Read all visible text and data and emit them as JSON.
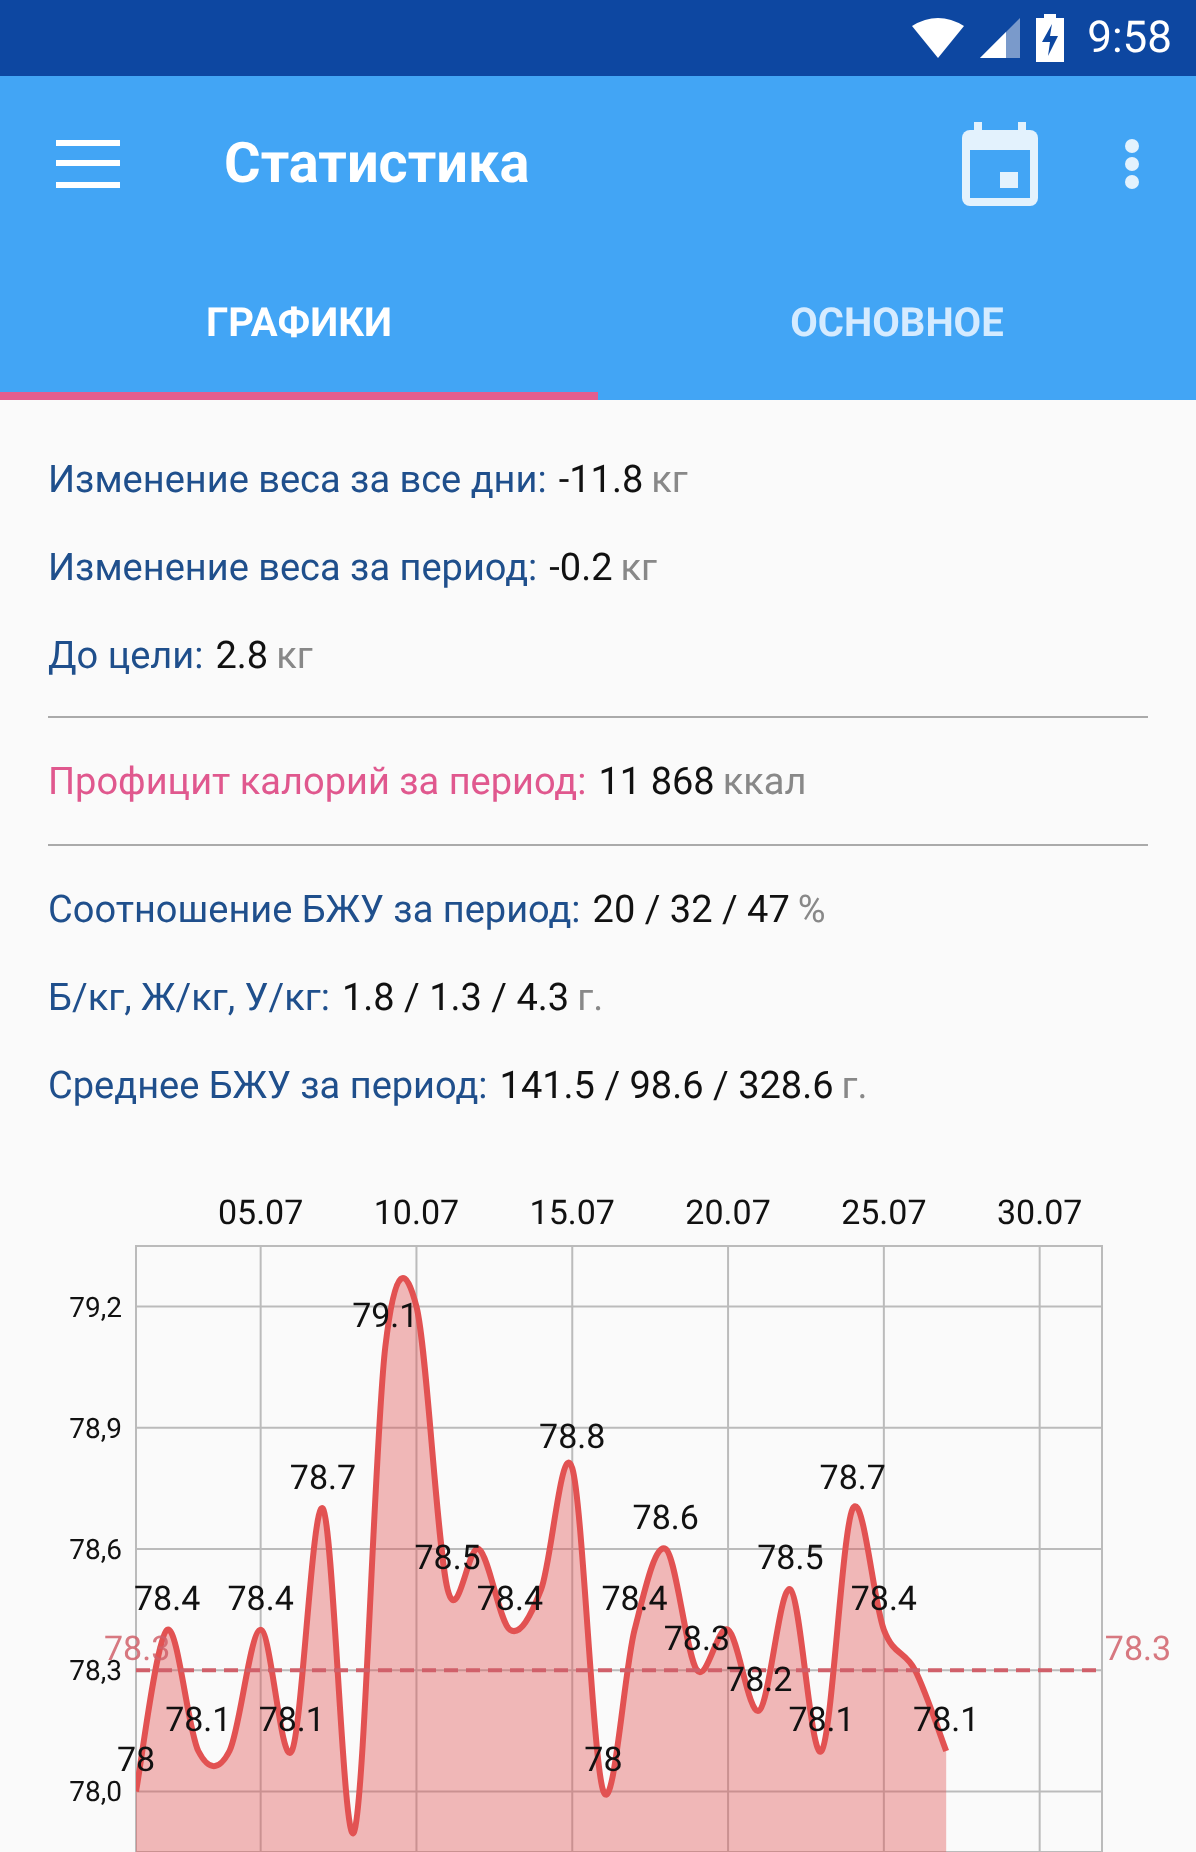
{
  "status_bar": {
    "time": "9:58"
  },
  "toolbar": {
    "title": "Статистика"
  },
  "tabs": [
    {
      "label": "ГРАФИКИ",
      "selected": true
    },
    {
      "label": "ОСНОВНОЕ",
      "selected": false
    }
  ],
  "sections": [
    {
      "rows": [
        {
          "kind": "normal",
          "label": "Изменение веса за все дни:",
          "value": "-11.8",
          "unit": "кг"
        },
        {
          "kind": "normal",
          "label": "Изменение веса за период:",
          "value": "-0.2",
          "unit": "кг"
        },
        {
          "kind": "normal",
          "label": "До цели:",
          "value": "2.8",
          "unit": "кг"
        }
      ]
    },
    {
      "rows": [
        {
          "kind": "highlight",
          "label": "Профицит калорий за период:",
          "value": "11 868",
          "unit": "ккал"
        }
      ]
    },
    {
      "rows": [
        {
          "kind": "normal",
          "label": "Соотношение БЖУ за период:",
          "value": "20 / 32 / 47",
          "unit": "%"
        },
        {
          "kind": "normal",
          "label": "Б/кг, Ж/кг, У/кг:",
          "value": "1.8 / 1.3 / 4.3",
          "unit": "г."
        },
        {
          "kind": "normal",
          "label": "Среднее БЖУ за период:",
          "value": "141.5 / 98.6 / 328.6",
          "unit": "г."
        }
      ]
    }
  ],
  "chart": {
    "chart_data": {
      "type": "area",
      "categories": [
        null,
        null,
        null,
        null,
        "05.07",
        null,
        null,
        null,
        null,
        "10.07",
        null,
        null,
        null,
        null,
        "15.07",
        null,
        null,
        null,
        null,
        "20.07",
        null,
        null,
        null,
        null,
        "25.07",
        null,
        null,
        null,
        null,
        "30.07",
        null,
        null
      ],
      "series": [
        {
          "color": "#e25252",
          "values": [
            78.0,
            78.4,
            78.1,
            78.1,
            78.4,
            78.1,
            78.7,
            77.9,
            79.1,
            79.2,
            78.5,
            78.6,
            78.4,
            78.5,
            78.8,
            78.0,
            78.4,
            78.6,
            78.3,
            78.4,
            78.2,
            78.5,
            78.1,
            78.7,
            78.4,
            78.3,
            78.1,
            null,
            null,
            null,
            null,
            null
          ]
        }
      ],
      "value_labels": [
        "78",
        "78.4",
        "78.1",
        null,
        "78.4",
        "78.1",
        "78.7",
        null,
        "79.1",
        null,
        "78.5",
        null,
        "78.4",
        null,
        "78.8",
        "78",
        "78.4",
        "78.6",
        "78.3",
        null,
        "78.2",
        "78.5",
        "78.1",
        "78.7",
        "78.4",
        null,
        "78.1",
        null,
        null,
        null,
        null,
        null
      ],
      "ylim": [
        77.85,
        79.35
      ],
      "yticks": [
        {
          "value": 78.0,
          "label": "78,0"
        },
        {
          "value": 78.3,
          "label": "78,3"
        },
        {
          "value": 78.6,
          "label": "78,6"
        },
        {
          "value": 78.9,
          "label": "78,9"
        },
        {
          "value": 79.2,
          "label": "79,2"
        }
      ],
      "grid": true,
      "ref_lines": [
        {
          "axis": "y",
          "value": 78.3,
          "label": "78.3",
          "color": "#d0606a"
        }
      ],
      "annotations": [
        "78.3"
      ]
    }
  }
}
